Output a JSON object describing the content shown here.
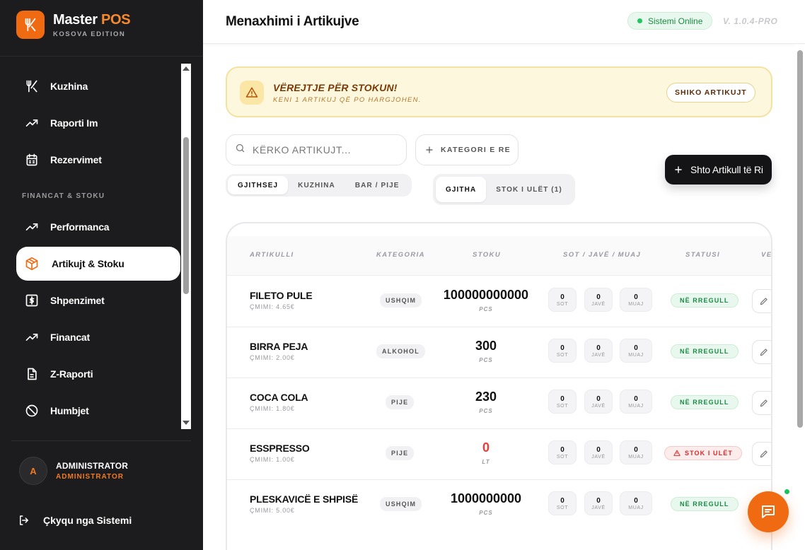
{
  "brand": {
    "name": "Master",
    "name_accent": "POS",
    "subtitle": "KOSOVA EDITION",
    "accent_color": "#f06a12"
  },
  "sidebar": {
    "items": [
      {
        "label": "Kuzhina",
        "icon": "utensils-icon"
      },
      {
        "label": "Raporti Im",
        "icon": "trend-up-icon"
      },
      {
        "label": "Rezervimet",
        "icon": "calendar-icon"
      }
    ],
    "section_label": "FINANCAT & STOKU",
    "section_items": [
      {
        "label": "Performanca",
        "icon": "trend-up-icon"
      },
      {
        "label": "Artikujt & Stoku",
        "icon": "box-icon",
        "active": true
      },
      {
        "label": "Shpenzimet",
        "icon": "dollar-icon"
      },
      {
        "label": "Financat",
        "icon": "trend-up-icon"
      },
      {
        "label": "Z-Raporti",
        "icon": "document-icon"
      },
      {
        "label": "Humbjet",
        "icon": "ban-icon"
      }
    ],
    "user": {
      "initial": "A",
      "name": "ADMINISTRATOR",
      "role": "ADMINISTRATOR"
    },
    "logout_label": "Çkyqu nga Sistemi"
  },
  "header": {
    "title": "Menaxhimi i Artikujve",
    "status": "Sistemi Online",
    "version": "V. 1.0.4-PRO"
  },
  "alert": {
    "title": "VËREJTJE PËR STOKUN!",
    "subtitle": "KENI 1 ARTIKUJ QË PO HARGJOHEN.",
    "button": "SHIKO ARTIKUJT"
  },
  "search": {
    "placeholder": "KËRKO ARTIKUJT..."
  },
  "category_button": "KATEGORI E RE",
  "add_button": "Shto Artikull të Ri",
  "filters": {
    "category_tabs": [
      {
        "label": "GJITHSEJ",
        "selected": true
      },
      {
        "label": "KUZHINA"
      },
      {
        "label": "BAR / PIJE"
      }
    ],
    "stock_tabs": [
      {
        "label": "GJITHA",
        "selected": true
      },
      {
        "label": "STOK I ULËT (1)"
      }
    ]
  },
  "table": {
    "columns": [
      "ARTIKULLI",
      "KATEGORIA",
      "STOKU",
      "SOT / JAVË / MUAJ",
      "STATUSI",
      "VE"
    ],
    "sales_labels": [
      "SOT",
      "JAVË",
      "MUAJ"
    ],
    "rows": [
      {
        "name": "FILETO PULE",
        "price": "ÇMIMI: 4.65€",
        "category": "USHQIM",
        "stock": "100000000000",
        "unit": "PCS",
        "sot": "0",
        "jave": "0",
        "muaj": "0",
        "status": "NË RREGULL"
      },
      {
        "name": "BIRRA PEJA",
        "price": "ÇMIMI: 2.00€",
        "category": "ALKOHOL",
        "stock": "300",
        "unit": "PCS",
        "sot": "0",
        "jave": "0",
        "muaj": "0",
        "status": "NË RREGULL"
      },
      {
        "name": "COCA COLA",
        "price": "ÇMIMI: 1.80€",
        "category": "PIJE",
        "stock": "230",
        "unit": "PCS",
        "sot": "0",
        "jave": "0",
        "muaj": "0",
        "status": "NË RREGULL"
      },
      {
        "name": "ESSPRESSO",
        "price": "ÇMIMI: 1.00€",
        "category": "PIJE",
        "stock": "0",
        "unit": "LT",
        "sot": "0",
        "jave": "0",
        "muaj": "0",
        "status": "STOK I ULËT"
      },
      {
        "name": "PLESKAVICË E SHPISË",
        "price": "ÇMIMI: 5.00€",
        "category": "USHQIM",
        "stock": "1000000000",
        "unit": "PCS",
        "sot": "0",
        "jave": "0",
        "muaj": "0",
        "status": "NË RREGULL"
      }
    ]
  }
}
